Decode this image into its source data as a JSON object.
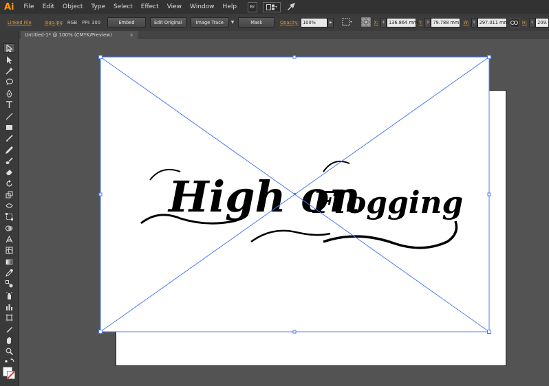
{
  "menubar": {
    "app_logo": "Ai",
    "items": [
      "File",
      "Edit",
      "Object",
      "Type",
      "Select",
      "Effect",
      "View",
      "Window",
      "Help"
    ],
    "bridge_label": "Br"
  },
  "controlbar": {
    "linked_file": "Linked File",
    "filename": "logo.jpg",
    "color_mode": "RGB",
    "ppi": "PPI: 300",
    "embed": "Embed",
    "edit_original": "Edit Original",
    "image_trace": "Image Trace",
    "mask": "Mask",
    "opacity_label": "Opacity:",
    "opacity_value": "100%",
    "x_label": "X:",
    "x_value": "136.864 mm",
    "y_label": "Y:",
    "y_value": "79.788 mm",
    "w_label": "W:",
    "w_value": "297.011 mm",
    "h_label": "H:",
    "h_value": "209."
  },
  "document": {
    "tab_title": "Untitled-1* @ 100% (CMYK/Preview)",
    "close": "×"
  },
  "image": {
    "text_line1": "High on",
    "text_line2": "Flogging"
  },
  "colors": {
    "selection": "#4a7cf3",
    "accent": "#e19730",
    "app_logo": "#ff9a00"
  }
}
